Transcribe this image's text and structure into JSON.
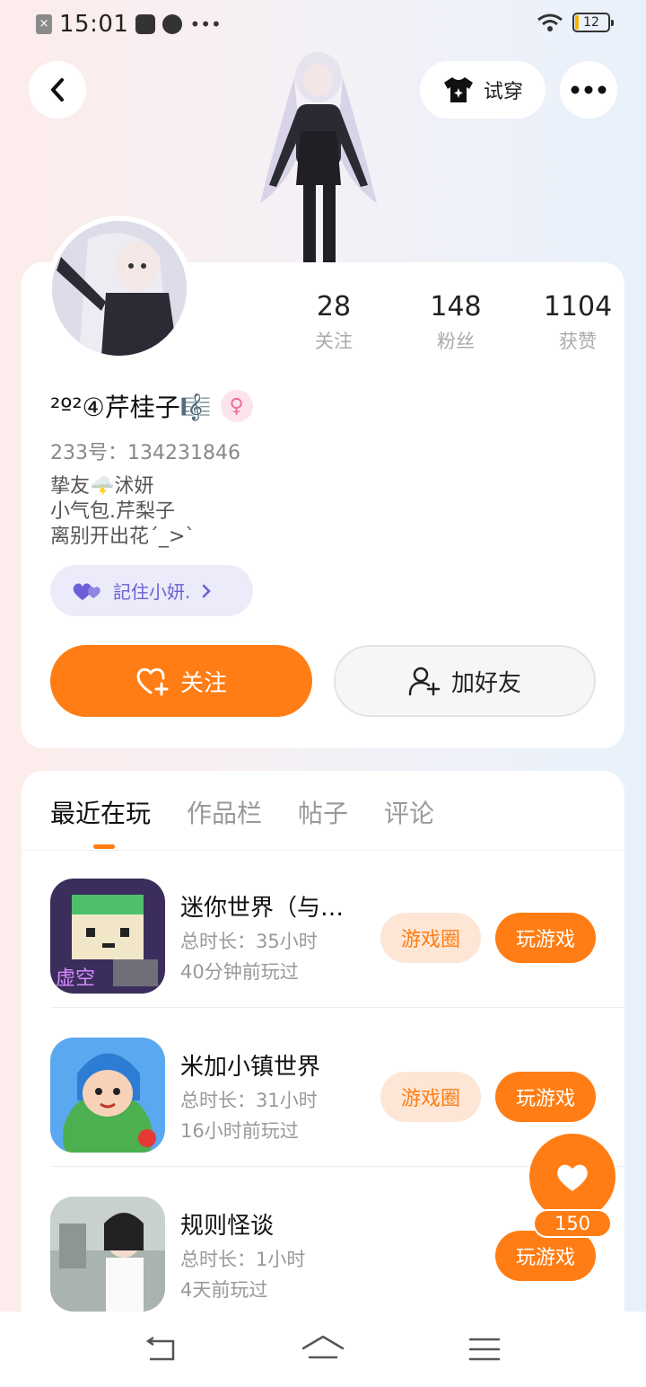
{
  "status_bar": {
    "time": "15:01",
    "battery": "12"
  },
  "header": {
    "tryon_label": "试穿"
  },
  "profile": {
    "stats": [
      {
        "num": "28",
        "label": "关注"
      },
      {
        "num": "148",
        "label": "粉丝"
      },
      {
        "num": "1104",
        "label": "获赞"
      }
    ],
    "username": "²º²④芹桂子🎼",
    "gender_symbol": "♀",
    "uid": "233号：134231846",
    "bio_lines": [
      "挚友🌩️沭妍",
      "小气包.芹梨子",
      "离别开出花´_>`"
    ],
    "tag_label": "記住小妍.",
    "follow_label": "关注",
    "add_friend_label": "加好友"
  },
  "tabs": [
    {
      "label": "最近在玩",
      "active": true
    },
    {
      "label": "作品栏",
      "active": false
    },
    {
      "label": "帖子",
      "active": false
    },
    {
      "label": "评论",
      "active": false
    }
  ],
  "games": [
    {
      "name": "迷你世界（与…",
      "duration": "总时长：35小时",
      "last_played": "40分钟前玩过",
      "circle_label": "游戏圈",
      "play_label": "玩游戏"
    },
    {
      "name": "米加小镇世界",
      "duration": "总时长：31小时",
      "last_played": "16小时前玩过",
      "circle_label": "游戏圈",
      "play_label": "玩游戏"
    },
    {
      "name": "规则怪谈",
      "duration": "总时长：1小时",
      "last_played": "4天前玩过",
      "play_label": "玩游戏"
    }
  ],
  "float_like": {
    "count": "150"
  },
  "colors": {
    "accent": "#ff7d14",
    "accent_light": "#fde6d6",
    "tag_bg": "#ecebfa",
    "tag_text": "#6b5fd6"
  }
}
